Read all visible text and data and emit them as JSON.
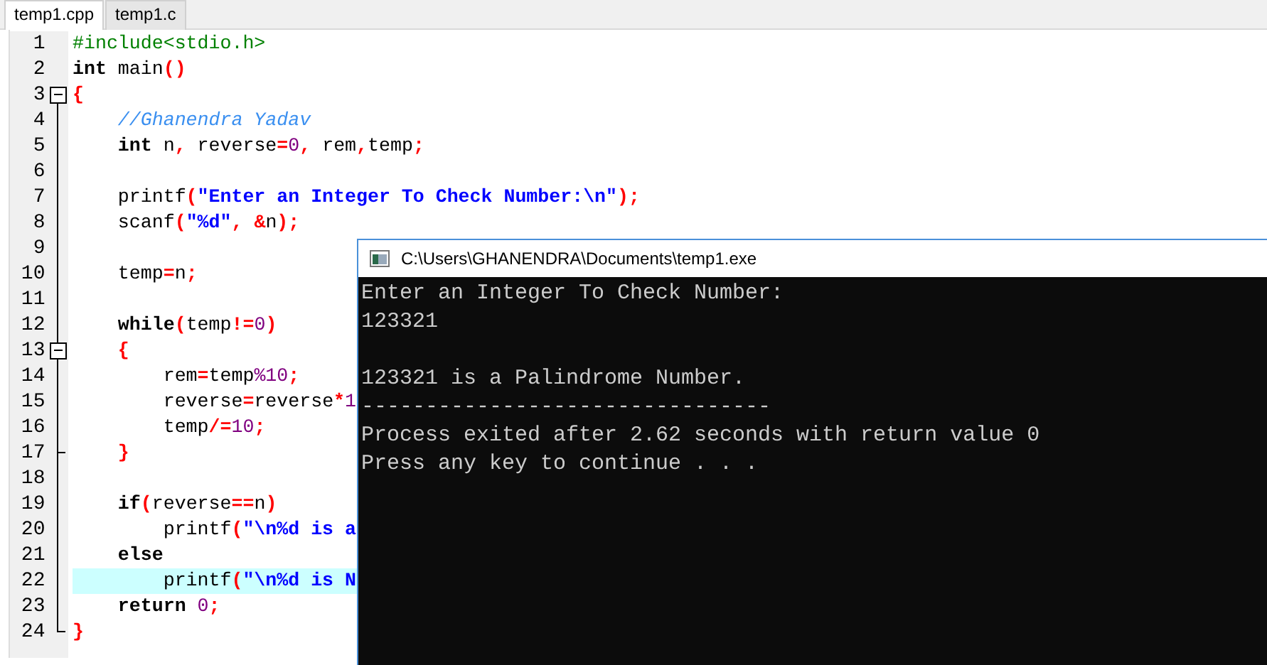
{
  "tabs": [
    {
      "label": "temp1.cpp",
      "selected": true
    },
    {
      "label": "temp1.c",
      "selected": false
    }
  ],
  "editor": {
    "lines": [
      {
        "number": "1",
        "fold_start": false,
        "fold_end": false,
        "highlighted": false,
        "tokens": [
          {
            "kind": "preproc",
            "text": "#include<stdio.h>"
          }
        ]
      },
      {
        "number": "2",
        "fold_start": false,
        "fold_end": false,
        "highlighted": false,
        "tokens": [
          {
            "kind": "keyword",
            "text": "int"
          },
          {
            "kind": "plain",
            "text": " main"
          },
          {
            "kind": "symbol",
            "text": "()"
          }
        ]
      },
      {
        "number": "3",
        "fold_start": true,
        "fold_end": false,
        "highlighted": false,
        "tokens": [
          {
            "kind": "symbol",
            "text": "{"
          }
        ]
      },
      {
        "number": "4",
        "fold_start": false,
        "fold_end": false,
        "highlighted": false,
        "tokens": [
          {
            "kind": "comment",
            "text": "    //Ghanendra Yadav"
          }
        ]
      },
      {
        "number": "5",
        "fold_start": false,
        "fold_end": false,
        "highlighted": false,
        "tokens": [
          {
            "kind": "keyword",
            "text": "    int"
          },
          {
            "kind": "plain",
            "text": " n"
          },
          {
            "kind": "symbol",
            "text": ","
          },
          {
            "kind": "plain",
            "text": " reverse"
          },
          {
            "kind": "symbol",
            "text": "="
          },
          {
            "kind": "number",
            "text": "0"
          },
          {
            "kind": "symbol",
            "text": ","
          },
          {
            "kind": "plain",
            "text": " rem"
          },
          {
            "kind": "symbol",
            "text": ","
          },
          {
            "kind": "plain",
            "text": "temp"
          },
          {
            "kind": "symbol",
            "text": ";"
          }
        ]
      },
      {
        "number": "6",
        "fold_start": false,
        "fold_end": false,
        "highlighted": false
      },
      {
        "number": "7",
        "fold_start": false,
        "fold_end": false,
        "highlighted": false,
        "tokens": [
          {
            "kind": "plain",
            "text": "    printf"
          },
          {
            "kind": "symbol",
            "text": "("
          },
          {
            "kind": "string",
            "text": "\"Enter an Integer To Check Number:\\n\""
          },
          {
            "kind": "symbol",
            "text": ");"
          }
        ]
      },
      {
        "number": "8",
        "fold_start": false,
        "fold_end": false,
        "highlighted": false,
        "tokens": [
          {
            "kind": "plain",
            "text": "    scanf"
          },
          {
            "kind": "symbol",
            "text": "("
          },
          {
            "kind": "string",
            "text": "\"%d\""
          },
          {
            "kind": "symbol",
            "text": ", &"
          },
          {
            "kind": "plain",
            "text": "n"
          },
          {
            "kind": "symbol",
            "text": ");"
          }
        ]
      },
      {
        "number": "9",
        "fold_start": false,
        "fold_end": false,
        "highlighted": false
      },
      {
        "number": "10",
        "fold_start": false,
        "fold_end": false,
        "highlighted": false,
        "tokens": [
          {
            "kind": "plain",
            "text": "    temp"
          },
          {
            "kind": "symbol",
            "text": "="
          },
          {
            "kind": "plain",
            "text": "n"
          },
          {
            "kind": "symbol",
            "text": ";"
          }
        ]
      },
      {
        "number": "11",
        "fold_start": false,
        "fold_end": false,
        "highlighted": false
      },
      {
        "number": "12",
        "fold_start": false,
        "fold_end": false,
        "highlighted": false,
        "tokens": [
          {
            "kind": "keyword",
            "text": "    while"
          },
          {
            "kind": "symbol",
            "text": "("
          },
          {
            "kind": "plain",
            "text": "temp"
          },
          {
            "kind": "symbol",
            "text": "!="
          },
          {
            "kind": "number",
            "text": "0"
          },
          {
            "kind": "symbol",
            "text": ")"
          }
        ]
      },
      {
        "number": "13",
        "fold_start": true,
        "fold_end": false,
        "highlighted": false,
        "tokens": [
          {
            "kind": "symbol",
            "text": "    {"
          }
        ]
      },
      {
        "number": "14",
        "fold_start": false,
        "fold_end": false,
        "highlighted": false,
        "tokens": [
          {
            "kind": "plain",
            "text": "        rem"
          },
          {
            "kind": "symbol",
            "text": "="
          },
          {
            "kind": "plain",
            "text": "temp"
          },
          {
            "kind": "number",
            "text": "%10"
          },
          {
            "kind": "symbol",
            "text": ";"
          }
        ]
      },
      {
        "number": "15",
        "fold_start": false,
        "fold_end": false,
        "highlighted": false,
        "tokens": [
          {
            "kind": "plain",
            "text": "        reverse"
          },
          {
            "kind": "symbol",
            "text": "="
          },
          {
            "kind": "plain",
            "text": "reverse"
          },
          {
            "kind": "symbol",
            "text": "*"
          },
          {
            "kind": "number",
            "text": "1"
          }
        ]
      },
      {
        "number": "16",
        "fold_start": false,
        "fold_end": false,
        "highlighted": false,
        "tokens": [
          {
            "kind": "plain",
            "text": "        temp"
          },
          {
            "kind": "symbol",
            "text": "/="
          },
          {
            "kind": "number",
            "text": "10"
          },
          {
            "kind": "symbol",
            "text": ";"
          }
        ]
      },
      {
        "number": "17",
        "fold_start": false,
        "fold_end": true,
        "highlighted": false,
        "tokens": [
          {
            "kind": "symbol",
            "text": "    }"
          }
        ]
      },
      {
        "number": "18",
        "fold_start": false,
        "fold_end": false,
        "highlighted": false
      },
      {
        "number": "19",
        "fold_start": false,
        "fold_end": false,
        "highlighted": false,
        "tokens": [
          {
            "kind": "keyword",
            "text": "    if"
          },
          {
            "kind": "symbol",
            "text": "("
          },
          {
            "kind": "plain",
            "text": "reverse"
          },
          {
            "kind": "symbol",
            "text": "=="
          },
          {
            "kind": "plain",
            "text": "n"
          },
          {
            "kind": "symbol",
            "text": ")"
          }
        ]
      },
      {
        "number": "20",
        "fold_start": false,
        "fold_end": false,
        "highlighted": false,
        "tokens": [
          {
            "kind": "plain",
            "text": "        printf"
          },
          {
            "kind": "symbol",
            "text": "("
          },
          {
            "kind": "string",
            "text": "\"\\n%d is a"
          }
        ]
      },
      {
        "number": "21",
        "fold_start": false,
        "fold_end": false,
        "highlighted": false,
        "tokens": [
          {
            "kind": "keyword",
            "text": "    else"
          }
        ]
      },
      {
        "number": "22",
        "fold_start": false,
        "fold_end": false,
        "highlighted": true,
        "tokens": [
          {
            "kind": "plain",
            "text": "        printf"
          },
          {
            "kind": "symbol",
            "text": "("
          },
          {
            "kind": "string",
            "text": "\"\\n%d is N"
          }
        ]
      },
      {
        "number": "23",
        "fold_start": false,
        "fold_end": false,
        "highlighted": false,
        "tokens": [
          {
            "kind": "keyword",
            "text": "    return"
          },
          {
            "kind": "number",
            "text": " 0"
          },
          {
            "kind": "symbol",
            "text": ";"
          }
        ]
      },
      {
        "number": "24",
        "fold_start": false,
        "fold_end": true,
        "highlighted": false,
        "tokens": [
          {
            "kind": "symbol",
            "text": "}"
          }
        ]
      }
    ]
  },
  "console": {
    "title": "C:\\Users\\GHANENDRA\\Documents\\temp1.exe",
    "paragraphs": [
      [
        "Enter an Integer To Check Number:",
        "123321"
      ],
      [
        "123321 is a Palindrome Number.",
        "--------------------------------",
        "Process exited after 2.62 seconds with return value 0",
        "Press any key to continue . . ."
      ]
    ]
  }
}
